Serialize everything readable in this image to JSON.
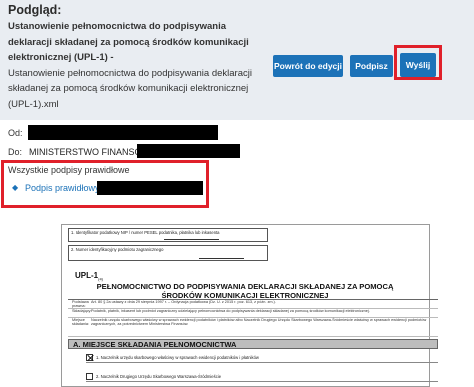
{
  "preview": {
    "title": "Podgląd:",
    "doc_name_bold": "Ustanowienie pełnomocnictwa do podpisywania deklaracji składanej za pomocą środków komunikacji elektronicznej (UPL-1) -",
    "doc_name_regular": "Ustanowienie pełnomocnictwa do podpisywania deklaracji składanej za pomocą środków komunikacji elektronicznej (UPL-1).xml"
  },
  "toolbar": {
    "back_label": "Powrót do edycji",
    "sign_label": "Podpisz",
    "send_label": "Wyślij"
  },
  "envelope": {
    "from_label": "Od:",
    "to_label": "Do:",
    "to_value": "MINISTERSTWO FINANSÓW"
  },
  "signatures": {
    "title": "Wszystkie podpisy prawidłowe",
    "items": [
      {
        "label": "Podpis prawidłowy -"
      }
    ]
  },
  "document": {
    "field1_label": "1. Identyfikator podatkowy NIP / numer PESEL podatnika, płatnika lub inkasenta",
    "field2_label": "2. Numer identyfikacyjny podmiotu zagranicznego",
    "form_code": "UPL-1",
    "form_version": "(4)",
    "title_line1": "PEŁNOMOCNICTWO DO PODPISYWANIA DEKLARACJI SKŁADANEJ ZA POMOCĄ",
    "title_line2": "ŚRODKÓW KOMUNIKACJI ELEKTRONICZNEJ",
    "info_rows": [
      {
        "k": "Podstawa prawna:",
        "v": "Art. 80 § 2a ustawy z dnia 29 sierpnia 1997 r. – Ordynacja podatkowa (Dz. U. z 2015 r. poz. 613, z późn. zm.)."
      },
      {
        "k": "Składający:",
        "v": "Podatnik, płatnik, inkasent lub podmiot zagraniczny udzielający pełnomocnictwa do podpisywania deklaracji składanej za pomocą środków komunikacji elektronicznej."
      },
      {
        "k": "Miejsce składania:",
        "v": "Naczelnik urzędu skarbowego właściwy w sprawach ewidencji podatników i płatników albo Naczelnik Drugiego Urzędu Skarbowego Warszawa-Śródmieście właściwy w sprawach ewidencji podmiotów zagranicznych, za pośrednictwem Ministerstwa Finansów."
      }
    ],
    "section_a": "A. MIEJSCE SKŁADANIA PEŁNOMOCNICTWA",
    "options": [
      {
        "label": "1. Naczelnik urzędu skarbowego właściwy w sprawach ewidencji podatników i płatników",
        "checked": true
      },
      {
        "label": "2. Naczelnik Drugiego Urzędu Skarbowego Warszawa-Śródmieście",
        "checked": false
      }
    ]
  }
}
